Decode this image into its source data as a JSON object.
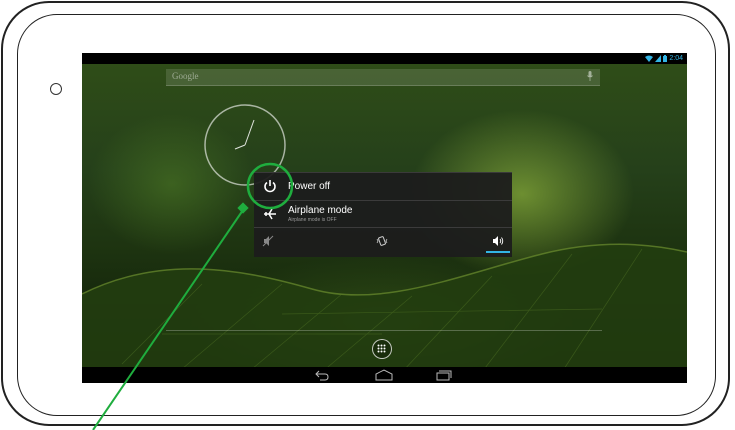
{
  "status_bar": {
    "time": "2:04",
    "icons": [
      "wifi-icon",
      "signal-icon",
      "battery-icon"
    ],
    "accent_color": "#33b5e5"
  },
  "search_bar": {
    "placeholder": "Google",
    "icon": "mic-icon"
  },
  "clock_widget": {
    "type": "analog"
  },
  "power_menu": {
    "items": [
      {
        "label": "Power off",
        "icon": "power-icon"
      },
      {
        "label": "Airplane mode",
        "sublabel": "Airplane mode is OFF",
        "icon": "airplane-icon"
      }
    ],
    "sound_modes": [
      {
        "name": "silent",
        "icon": "sound-off-icon",
        "active": false
      },
      {
        "name": "vibrate",
        "icon": "vibrate-icon",
        "active": false
      },
      {
        "name": "sound-on",
        "icon": "sound-on-icon",
        "active": true
      }
    ]
  },
  "launcher": {
    "all_apps_icon": "all-apps-icon"
  },
  "nav_bar": {
    "buttons": [
      "back-icon",
      "home-icon",
      "recents-icon"
    ]
  },
  "annotation": {
    "highlight_color": "#1fad3e",
    "target": "power-icon"
  }
}
